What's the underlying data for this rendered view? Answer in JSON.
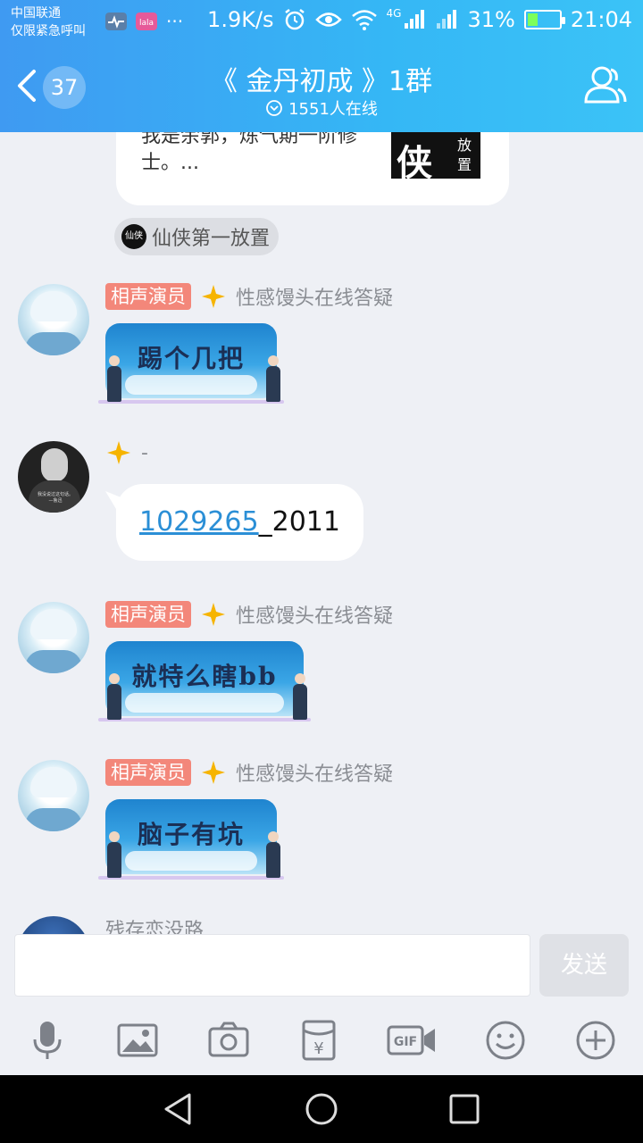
{
  "status_bar": {
    "carrier_line1": "中国联通",
    "carrier_line2": "仅限紧急呼叫",
    "more": "···",
    "speed": "1.9K/s",
    "network": "4G",
    "battery": "31%",
    "battery_level": 0.31,
    "time": "21:04"
  },
  "header": {
    "back_count": "37",
    "title": "《 金丹初成 》1群",
    "online": "1551人在线"
  },
  "card": {
    "text": "我是余郭，炼气期一阶修士。...",
    "logo_big": "侠",
    "logo_small": "放置",
    "source_icon": "仙侠",
    "source": "仙侠第一放置"
  },
  "messages": [
    {
      "type": "sticker",
      "role": "相声演员",
      "name": "性感馒头在线答疑",
      "sticker": "踢个几把"
    },
    {
      "type": "text",
      "role": "",
      "name": "-",
      "link": "1029265",
      "rest": "_2011"
    },
    {
      "type": "sticker",
      "role": "相声演员",
      "name": "性感馒头在线答疑",
      "sticker": "就特么瞎bb"
    },
    {
      "type": "sticker",
      "role": "相声演员",
      "name": "性感馒头在线答疑",
      "sticker": "脑子有坑"
    },
    {
      "type": "partial",
      "name": "残存恋没路"
    }
  ],
  "avatar_caption": "我没说过这句话。 —鲁迅",
  "input": {
    "placeholder": "",
    "send_label": "发送"
  },
  "colors": {
    "header_start": "#3f9af2",
    "header_end": "#3bc3f7",
    "role_badge": "#f3877a",
    "link": "#2b8fd6"
  }
}
